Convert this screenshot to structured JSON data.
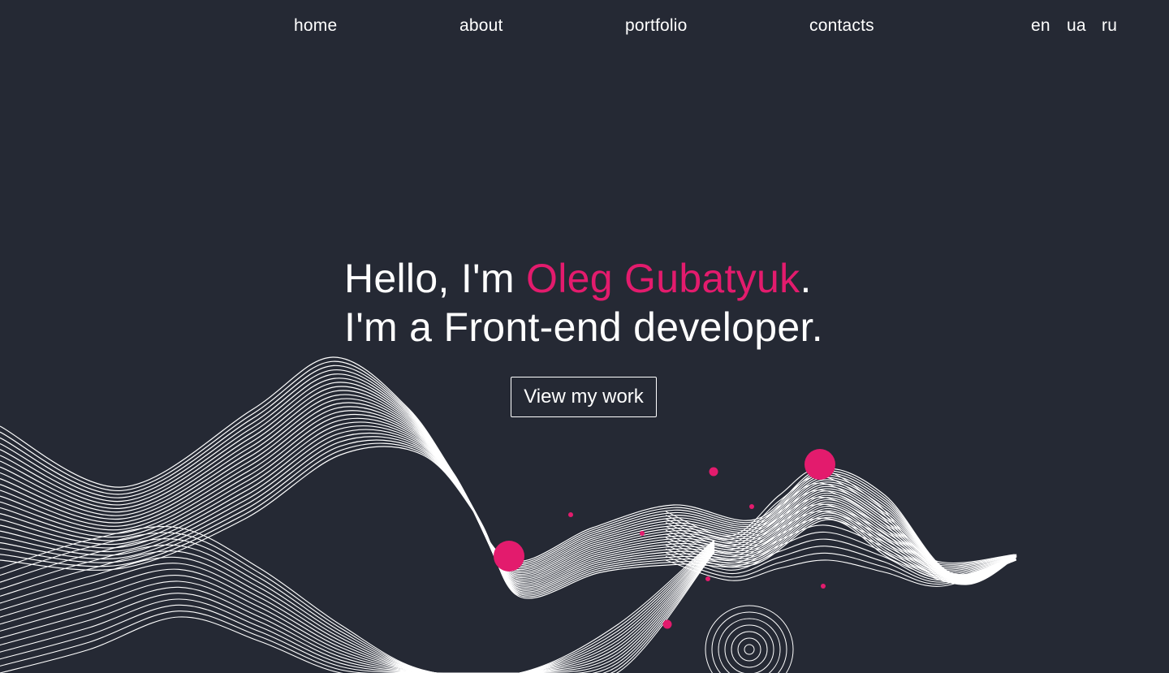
{
  "nav": {
    "items": [
      {
        "label": "home"
      },
      {
        "label": "about"
      },
      {
        "label": "portfolio"
      },
      {
        "label": "contacts"
      }
    ],
    "languages": [
      {
        "label": "en"
      },
      {
        "label": "ua"
      },
      {
        "label": "ru"
      }
    ]
  },
  "hero": {
    "greeting_prefix": "Hello, I'm ",
    "name": "Oleg Gubatyuk",
    "greeting_suffix": ".",
    "subtitle": "I'm a Front-end developer.",
    "cta_label": "View my work"
  },
  "colors": {
    "background": "#252934",
    "accent": "#e31b6d",
    "text": "#ffffff"
  }
}
